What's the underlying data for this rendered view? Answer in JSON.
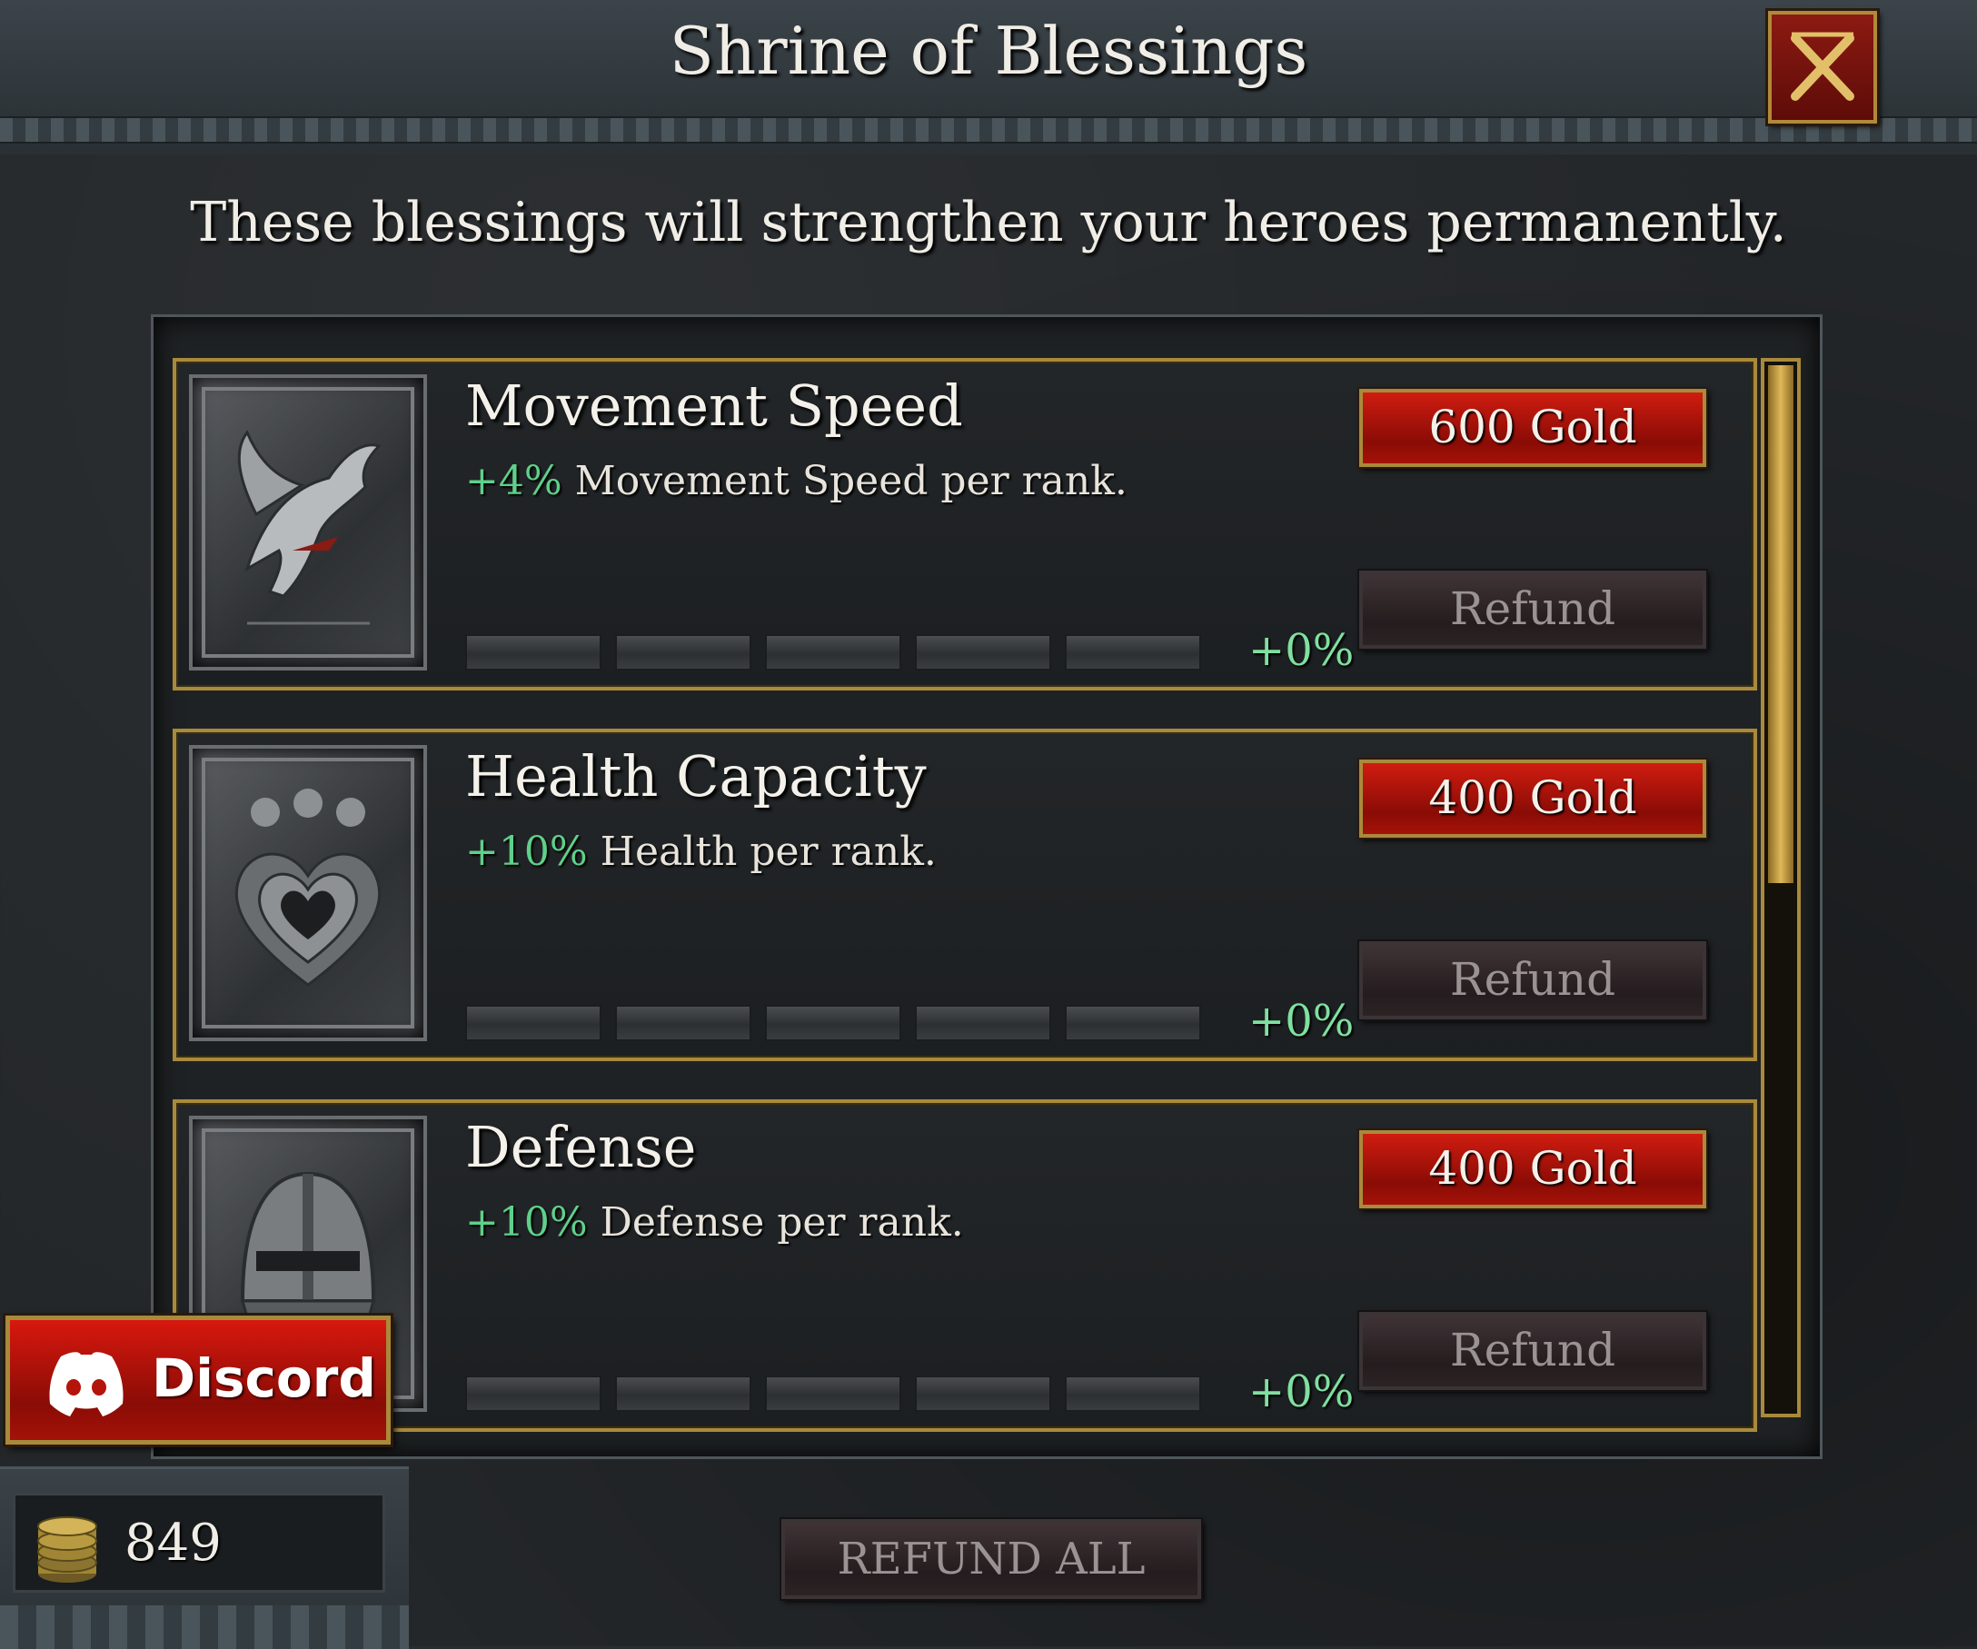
{
  "header": {
    "title": "Shrine of Blessings",
    "close_icon": "close-icon"
  },
  "subtitle": "These blessings will strengthen your heroes permanently.",
  "blessings": [
    {
      "title": "Movement Speed",
      "desc_pct": "+4%",
      "desc_text": " Movement Speed per rank.",
      "ranks_filled": 0,
      "ranks_total": 5,
      "bonus": "+0%",
      "cost_label": "600 Gold",
      "refund_label": "Refund",
      "icon": "pegasus-icon"
    },
    {
      "title": "Health Capacity",
      "desc_pct": "+10%",
      "desc_text": " Health per rank.",
      "ranks_filled": 0,
      "ranks_total": 5,
      "bonus": "+0%",
      "cost_label": "400 Gold",
      "refund_label": "Refund",
      "icon": "heart-icon"
    },
    {
      "title": "Defense",
      "desc_pct": "+10%",
      "desc_text": " Defense per rank.",
      "ranks_filled": 0,
      "ranks_total": 5,
      "bonus": "+0%",
      "cost_label": "400 Gold",
      "refund_label": "Refund",
      "icon": "helmet-icon"
    }
  ],
  "refund_all_label": "REFUND ALL",
  "discord": {
    "label": "Discord",
    "icon": "discord-icon"
  },
  "gold": {
    "value": "849",
    "icon": "coin-stack-icon"
  },
  "colors": {
    "accent_gold": "#a98a3c",
    "buy_red": "#b4140a",
    "bonus_green": "#7fe0a0"
  }
}
